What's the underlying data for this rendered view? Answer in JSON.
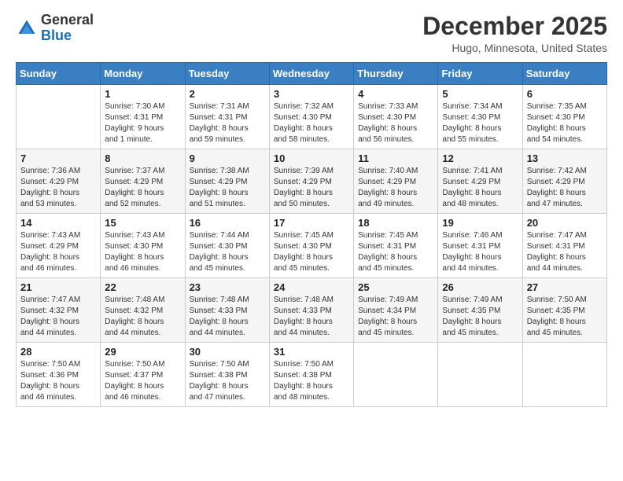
{
  "logo": {
    "general": "General",
    "blue": "Blue"
  },
  "title": "December 2025",
  "location": "Hugo, Minnesota, United States",
  "days_of_week": [
    "Sunday",
    "Monday",
    "Tuesday",
    "Wednesday",
    "Thursday",
    "Friday",
    "Saturday"
  ],
  "weeks": [
    [
      {
        "day": "",
        "info": ""
      },
      {
        "day": "1",
        "info": "Sunrise: 7:30 AM\nSunset: 4:31 PM\nDaylight: 9 hours\nand 1 minute."
      },
      {
        "day": "2",
        "info": "Sunrise: 7:31 AM\nSunset: 4:31 PM\nDaylight: 8 hours\nand 59 minutes."
      },
      {
        "day": "3",
        "info": "Sunrise: 7:32 AM\nSunset: 4:30 PM\nDaylight: 8 hours\nand 58 minutes."
      },
      {
        "day": "4",
        "info": "Sunrise: 7:33 AM\nSunset: 4:30 PM\nDaylight: 8 hours\nand 56 minutes."
      },
      {
        "day": "5",
        "info": "Sunrise: 7:34 AM\nSunset: 4:30 PM\nDaylight: 8 hours\nand 55 minutes."
      },
      {
        "day": "6",
        "info": "Sunrise: 7:35 AM\nSunset: 4:30 PM\nDaylight: 8 hours\nand 54 minutes."
      }
    ],
    [
      {
        "day": "7",
        "info": "Sunrise: 7:36 AM\nSunset: 4:29 PM\nDaylight: 8 hours\nand 53 minutes."
      },
      {
        "day": "8",
        "info": "Sunrise: 7:37 AM\nSunset: 4:29 PM\nDaylight: 8 hours\nand 52 minutes."
      },
      {
        "day": "9",
        "info": "Sunrise: 7:38 AM\nSunset: 4:29 PM\nDaylight: 8 hours\nand 51 minutes."
      },
      {
        "day": "10",
        "info": "Sunrise: 7:39 AM\nSunset: 4:29 PM\nDaylight: 8 hours\nand 50 minutes."
      },
      {
        "day": "11",
        "info": "Sunrise: 7:40 AM\nSunset: 4:29 PM\nDaylight: 8 hours\nand 49 minutes."
      },
      {
        "day": "12",
        "info": "Sunrise: 7:41 AM\nSunset: 4:29 PM\nDaylight: 8 hours\nand 48 minutes."
      },
      {
        "day": "13",
        "info": "Sunrise: 7:42 AM\nSunset: 4:29 PM\nDaylight: 8 hours\nand 47 minutes."
      }
    ],
    [
      {
        "day": "14",
        "info": "Sunrise: 7:43 AM\nSunset: 4:29 PM\nDaylight: 8 hours\nand 46 minutes."
      },
      {
        "day": "15",
        "info": "Sunrise: 7:43 AM\nSunset: 4:30 PM\nDaylight: 8 hours\nand 46 minutes."
      },
      {
        "day": "16",
        "info": "Sunrise: 7:44 AM\nSunset: 4:30 PM\nDaylight: 8 hours\nand 45 minutes."
      },
      {
        "day": "17",
        "info": "Sunrise: 7:45 AM\nSunset: 4:30 PM\nDaylight: 8 hours\nand 45 minutes."
      },
      {
        "day": "18",
        "info": "Sunrise: 7:45 AM\nSunset: 4:31 PM\nDaylight: 8 hours\nand 45 minutes."
      },
      {
        "day": "19",
        "info": "Sunrise: 7:46 AM\nSunset: 4:31 PM\nDaylight: 8 hours\nand 44 minutes."
      },
      {
        "day": "20",
        "info": "Sunrise: 7:47 AM\nSunset: 4:31 PM\nDaylight: 8 hours\nand 44 minutes."
      }
    ],
    [
      {
        "day": "21",
        "info": "Sunrise: 7:47 AM\nSunset: 4:32 PM\nDaylight: 8 hours\nand 44 minutes."
      },
      {
        "day": "22",
        "info": "Sunrise: 7:48 AM\nSunset: 4:32 PM\nDaylight: 8 hours\nand 44 minutes."
      },
      {
        "day": "23",
        "info": "Sunrise: 7:48 AM\nSunset: 4:33 PM\nDaylight: 8 hours\nand 44 minutes."
      },
      {
        "day": "24",
        "info": "Sunrise: 7:48 AM\nSunset: 4:33 PM\nDaylight: 8 hours\nand 44 minutes."
      },
      {
        "day": "25",
        "info": "Sunrise: 7:49 AM\nSunset: 4:34 PM\nDaylight: 8 hours\nand 45 minutes."
      },
      {
        "day": "26",
        "info": "Sunrise: 7:49 AM\nSunset: 4:35 PM\nDaylight: 8 hours\nand 45 minutes."
      },
      {
        "day": "27",
        "info": "Sunrise: 7:50 AM\nSunset: 4:35 PM\nDaylight: 8 hours\nand 45 minutes."
      }
    ],
    [
      {
        "day": "28",
        "info": "Sunrise: 7:50 AM\nSunset: 4:36 PM\nDaylight: 8 hours\nand 46 minutes."
      },
      {
        "day": "29",
        "info": "Sunrise: 7:50 AM\nSunset: 4:37 PM\nDaylight: 8 hours\nand 46 minutes."
      },
      {
        "day": "30",
        "info": "Sunrise: 7:50 AM\nSunset: 4:38 PM\nDaylight: 8 hours\nand 47 minutes."
      },
      {
        "day": "31",
        "info": "Sunrise: 7:50 AM\nSunset: 4:38 PM\nDaylight: 8 hours\nand 48 minutes."
      },
      {
        "day": "",
        "info": ""
      },
      {
        "day": "",
        "info": ""
      },
      {
        "day": "",
        "info": ""
      }
    ]
  ]
}
